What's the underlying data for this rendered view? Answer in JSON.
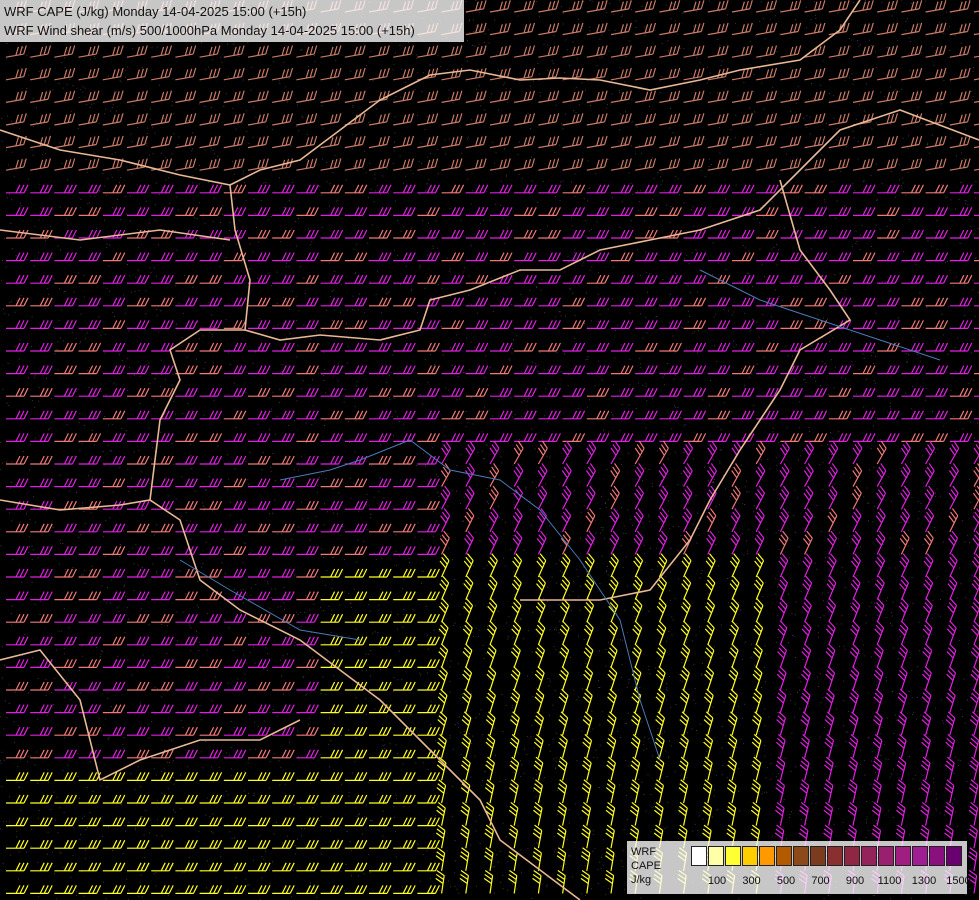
{
  "header": {
    "cape_title": "WRF CAPE (J/kg) Monday 14-04-2025 15:00 (+15h)",
    "shear_title": "WRF Wind shear (m/s) 500/1000hPa Monday 14-04-2025 15:00 (+15h)"
  },
  "legend": {
    "line1": "WRF",
    "line2": "CAPE",
    "line3": "J/kg",
    "ticks": [
      "100",
      "300",
      "500",
      "700",
      "900",
      "1100",
      "1300",
      "1500"
    ],
    "colors": [
      "#ffffff",
      "#ffffa8",
      "#ffff33",
      "#ffcc00",
      "#ff9900",
      "#b35900",
      "#8c4a1a",
      "#7a3b1f",
      "#8a2f2f",
      "#8f2744",
      "#93235a",
      "#99206e",
      "#a01e82",
      "#a01e93",
      "#8a1080",
      "#6a0070"
    ]
  },
  "map_colors": {
    "background": "#000000",
    "border": "#e8b896",
    "river": "#4a7ab8",
    "terrain_contour": "#8c8c8c",
    "barb_low": "#c87a66",
    "barb_mid": "#f07878",
    "barb_high": "#e020e0",
    "barb_yellow": "#ffff20",
    "barb_tan": "#d8a070"
  }
}
